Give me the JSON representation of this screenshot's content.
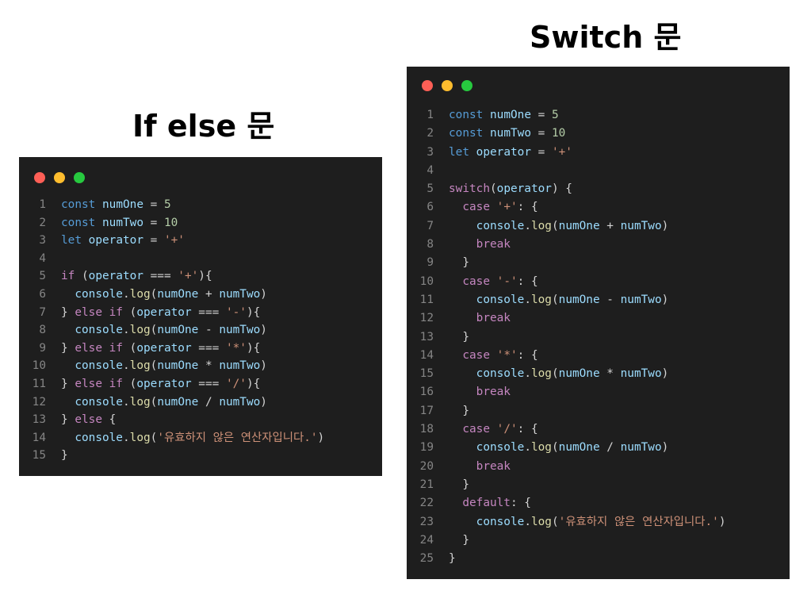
{
  "titles": {
    "if_else": "If else 문",
    "switch": "Switch 문"
  },
  "colors": {
    "window_bg": "#1e1e1e",
    "dot_red": "#ff5f56",
    "dot_yellow": "#ffbd2e",
    "dot_green": "#27c93f",
    "keyword": "#c586c0",
    "declaration": "#569cd6",
    "variable": "#9cdcfe",
    "number": "#b5cea8",
    "string": "#ce9178",
    "function": "#dcdcaa",
    "line_number": "#858585"
  },
  "if_code": [
    {
      "n": "1",
      "tokens": [
        [
          "decl",
          "const"
        ],
        [
          "plain",
          " "
        ],
        [
          "var",
          "numOne"
        ],
        [
          "op",
          " = "
        ],
        [
          "num",
          "5"
        ]
      ]
    },
    {
      "n": "2",
      "tokens": [
        [
          "decl",
          "const"
        ],
        [
          "plain",
          " "
        ],
        [
          "var",
          "numTwo"
        ],
        [
          "op",
          " = "
        ],
        [
          "num",
          "10"
        ]
      ]
    },
    {
      "n": "3",
      "tokens": [
        [
          "decl",
          "let"
        ],
        [
          "plain",
          " "
        ],
        [
          "var",
          "operator"
        ],
        [
          "op",
          " = "
        ],
        [
          "str",
          "'+'"
        ]
      ]
    },
    {
      "n": "4",
      "tokens": []
    },
    {
      "n": "5",
      "tokens": [
        [
          "kw",
          "if"
        ],
        [
          "plain",
          " ("
        ],
        [
          "var",
          "operator"
        ],
        [
          "op",
          " === "
        ],
        [
          "str",
          "'+'"
        ],
        [
          "plain",
          "){"
        ]
      ]
    },
    {
      "n": "6",
      "tokens": [
        [
          "plain",
          "  "
        ],
        [
          "var",
          "console"
        ],
        [
          "plain",
          "."
        ],
        [
          "fn",
          "log"
        ],
        [
          "plain",
          "("
        ],
        [
          "var",
          "numOne"
        ],
        [
          "op",
          " + "
        ],
        [
          "var",
          "numTwo"
        ],
        [
          "plain",
          ")"
        ]
      ]
    },
    {
      "n": "7",
      "tokens": [
        [
          "plain",
          "} "
        ],
        [
          "kw",
          "else if"
        ],
        [
          "plain",
          " ("
        ],
        [
          "var",
          "operator"
        ],
        [
          "op",
          " === "
        ],
        [
          "str",
          "'-'"
        ],
        [
          "plain",
          "){"
        ]
      ]
    },
    {
      "n": "8",
      "tokens": [
        [
          "plain",
          "  "
        ],
        [
          "var",
          "console"
        ],
        [
          "plain",
          "."
        ],
        [
          "fn",
          "log"
        ],
        [
          "plain",
          "("
        ],
        [
          "var",
          "numOne"
        ],
        [
          "op",
          " - "
        ],
        [
          "var",
          "numTwo"
        ],
        [
          "plain",
          ")"
        ]
      ]
    },
    {
      "n": "9",
      "tokens": [
        [
          "plain",
          "} "
        ],
        [
          "kw",
          "else if"
        ],
        [
          "plain",
          " ("
        ],
        [
          "var",
          "operator"
        ],
        [
          "op",
          " === "
        ],
        [
          "str",
          "'*'"
        ],
        [
          "plain",
          "){"
        ]
      ]
    },
    {
      "n": "10",
      "tokens": [
        [
          "plain",
          "  "
        ],
        [
          "var",
          "console"
        ],
        [
          "plain",
          "."
        ],
        [
          "fn",
          "log"
        ],
        [
          "plain",
          "("
        ],
        [
          "var",
          "numOne"
        ],
        [
          "op",
          " * "
        ],
        [
          "var",
          "numTwo"
        ],
        [
          "plain",
          ")"
        ]
      ]
    },
    {
      "n": "11",
      "tokens": [
        [
          "plain",
          "} "
        ],
        [
          "kw",
          "else if"
        ],
        [
          "plain",
          " ("
        ],
        [
          "var",
          "operator"
        ],
        [
          "op",
          " === "
        ],
        [
          "str",
          "'/'"
        ],
        [
          "plain",
          "){"
        ]
      ]
    },
    {
      "n": "12",
      "tokens": [
        [
          "plain",
          "  "
        ],
        [
          "var",
          "console"
        ],
        [
          "plain",
          "."
        ],
        [
          "fn",
          "log"
        ],
        [
          "plain",
          "("
        ],
        [
          "var",
          "numOne"
        ],
        [
          "op",
          " / "
        ],
        [
          "var",
          "numTwo"
        ],
        [
          "plain",
          ")"
        ]
      ]
    },
    {
      "n": "13",
      "tokens": [
        [
          "plain",
          "} "
        ],
        [
          "kw",
          "else"
        ],
        [
          "plain",
          " {"
        ]
      ]
    },
    {
      "n": "14",
      "tokens": [
        [
          "plain",
          "  "
        ],
        [
          "var",
          "console"
        ],
        [
          "plain",
          "."
        ],
        [
          "fn",
          "log"
        ],
        [
          "plain",
          "("
        ],
        [
          "str",
          "'유효하지 않은 연산자입니다.'"
        ],
        [
          "plain",
          ")"
        ]
      ]
    },
    {
      "n": "15",
      "tokens": [
        [
          "plain",
          "}"
        ]
      ]
    }
  ],
  "switch_code": [
    {
      "n": "1",
      "tokens": [
        [
          "decl",
          "const"
        ],
        [
          "plain",
          " "
        ],
        [
          "var",
          "numOne"
        ],
        [
          "op",
          " = "
        ],
        [
          "num",
          "5"
        ]
      ]
    },
    {
      "n": "2",
      "tokens": [
        [
          "decl",
          "const"
        ],
        [
          "plain",
          " "
        ],
        [
          "var",
          "numTwo"
        ],
        [
          "op",
          " = "
        ],
        [
          "num",
          "10"
        ]
      ]
    },
    {
      "n": "3",
      "tokens": [
        [
          "decl",
          "let"
        ],
        [
          "plain",
          " "
        ],
        [
          "var",
          "operator"
        ],
        [
          "op",
          " = "
        ],
        [
          "str",
          "'+'"
        ]
      ]
    },
    {
      "n": "4",
      "tokens": []
    },
    {
      "n": "5",
      "tokens": [
        [
          "kw",
          "switch"
        ],
        [
          "plain",
          "("
        ],
        [
          "var",
          "operator"
        ],
        [
          "plain",
          ") {"
        ]
      ]
    },
    {
      "n": "6",
      "tokens": [
        [
          "plain",
          "  "
        ],
        [
          "kw",
          "case"
        ],
        [
          "plain",
          " "
        ],
        [
          "str",
          "'+'"
        ],
        [
          "plain",
          ": {"
        ]
      ]
    },
    {
      "n": "7",
      "tokens": [
        [
          "plain",
          "    "
        ],
        [
          "var",
          "console"
        ],
        [
          "plain",
          "."
        ],
        [
          "fn",
          "log"
        ],
        [
          "plain",
          "("
        ],
        [
          "var",
          "numOne"
        ],
        [
          "op",
          " + "
        ],
        [
          "var",
          "numTwo"
        ],
        [
          "plain",
          ")"
        ]
      ]
    },
    {
      "n": "8",
      "tokens": [
        [
          "plain",
          "    "
        ],
        [
          "kw",
          "break"
        ]
      ]
    },
    {
      "n": "9",
      "tokens": [
        [
          "plain",
          "  }"
        ]
      ]
    },
    {
      "n": "10",
      "tokens": [
        [
          "plain",
          "  "
        ],
        [
          "kw",
          "case"
        ],
        [
          "plain",
          " "
        ],
        [
          "str",
          "'-'"
        ],
        [
          "plain",
          ": {"
        ]
      ]
    },
    {
      "n": "11",
      "tokens": [
        [
          "plain",
          "    "
        ],
        [
          "var",
          "console"
        ],
        [
          "plain",
          "."
        ],
        [
          "fn",
          "log"
        ],
        [
          "plain",
          "("
        ],
        [
          "var",
          "numOne"
        ],
        [
          "op",
          " - "
        ],
        [
          "var",
          "numTwo"
        ],
        [
          "plain",
          ")"
        ]
      ]
    },
    {
      "n": "12",
      "tokens": [
        [
          "plain",
          "    "
        ],
        [
          "kw",
          "break"
        ]
      ]
    },
    {
      "n": "13",
      "tokens": [
        [
          "plain",
          "  }"
        ]
      ]
    },
    {
      "n": "14",
      "tokens": [
        [
          "plain",
          "  "
        ],
        [
          "kw",
          "case"
        ],
        [
          "plain",
          " "
        ],
        [
          "str",
          "'*'"
        ],
        [
          "plain",
          ": {"
        ]
      ]
    },
    {
      "n": "15",
      "tokens": [
        [
          "plain",
          "    "
        ],
        [
          "var",
          "console"
        ],
        [
          "plain",
          "."
        ],
        [
          "fn",
          "log"
        ],
        [
          "plain",
          "("
        ],
        [
          "var",
          "numOne"
        ],
        [
          "op",
          " * "
        ],
        [
          "var",
          "numTwo"
        ],
        [
          "plain",
          ")"
        ]
      ]
    },
    {
      "n": "16",
      "tokens": [
        [
          "plain",
          "    "
        ],
        [
          "kw",
          "break"
        ]
      ]
    },
    {
      "n": "17",
      "tokens": [
        [
          "plain",
          "  }"
        ]
      ]
    },
    {
      "n": "18",
      "tokens": [
        [
          "plain",
          "  "
        ],
        [
          "kw",
          "case"
        ],
        [
          "plain",
          " "
        ],
        [
          "str",
          "'/'"
        ],
        [
          "plain",
          ": {"
        ]
      ]
    },
    {
      "n": "19",
      "tokens": [
        [
          "plain",
          "    "
        ],
        [
          "var",
          "console"
        ],
        [
          "plain",
          "."
        ],
        [
          "fn",
          "log"
        ],
        [
          "plain",
          "("
        ],
        [
          "var",
          "numOne"
        ],
        [
          "op",
          " / "
        ],
        [
          "var",
          "numTwo"
        ],
        [
          "plain",
          ")"
        ]
      ]
    },
    {
      "n": "20",
      "tokens": [
        [
          "plain",
          "    "
        ],
        [
          "kw",
          "break"
        ]
      ]
    },
    {
      "n": "21",
      "tokens": [
        [
          "plain",
          "  }"
        ]
      ]
    },
    {
      "n": "22",
      "tokens": [
        [
          "plain",
          "  "
        ],
        [
          "kw",
          "default"
        ],
        [
          "plain",
          ": {"
        ]
      ]
    },
    {
      "n": "23",
      "tokens": [
        [
          "plain",
          "    "
        ],
        [
          "var",
          "console"
        ],
        [
          "plain",
          "."
        ],
        [
          "fn",
          "log"
        ],
        [
          "plain",
          "("
        ],
        [
          "str",
          "'유효하지 않은 연산자입니다.'"
        ],
        [
          "plain",
          ")"
        ]
      ]
    },
    {
      "n": "24",
      "tokens": [
        [
          "plain",
          "  }"
        ]
      ]
    },
    {
      "n": "25",
      "tokens": [
        [
          "plain",
          "}"
        ]
      ]
    }
  ]
}
